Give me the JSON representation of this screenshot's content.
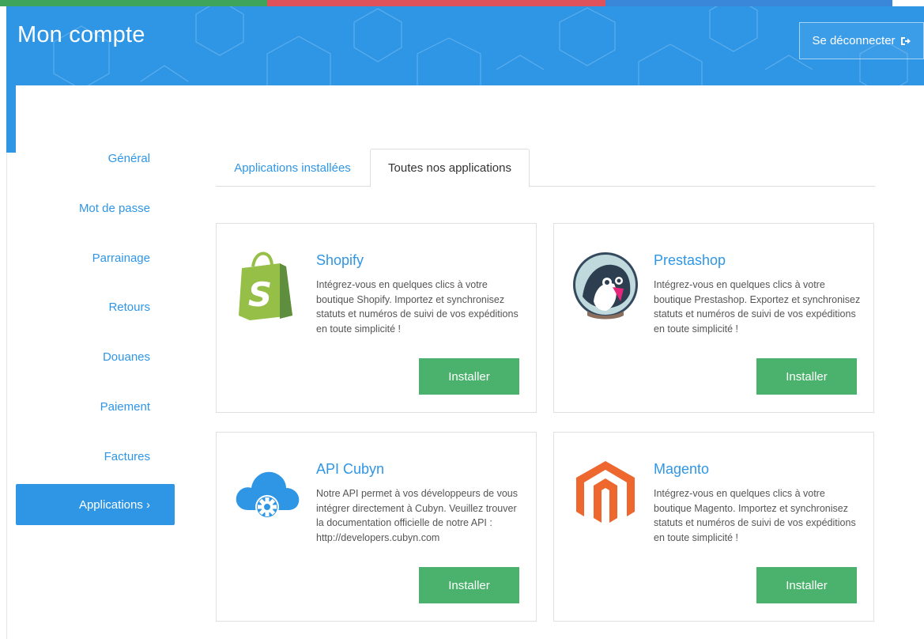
{
  "header": {
    "title": "Mon compte",
    "logout_label": "Se déconnecter",
    "logout_icon": "sign-out-icon"
  },
  "sidebar": {
    "items": [
      {
        "label": "Général"
      },
      {
        "label": "Mot de passe"
      },
      {
        "label": "Parrainage"
      },
      {
        "label": "Retours"
      },
      {
        "label": "Douanes"
      },
      {
        "label": "Paiement"
      },
      {
        "label": "Factures"
      },
      {
        "label": "Applications ›",
        "active": true
      }
    ]
  },
  "tabs": [
    {
      "label": "Applications installées",
      "active": false
    },
    {
      "label": "Toutes nos applications",
      "active": true
    }
  ],
  "apps": [
    {
      "name": "Shopify",
      "icon": "shopify-logo",
      "description": "Intégrez-vous en quelques clics à votre boutique Shopify. Importez et synchronisez statuts et numéros de suivi de vos expéditions en toute simplicité !",
      "button_label": "Installer"
    },
    {
      "name": "Prestashop",
      "icon": "prestashop-logo",
      "description": "Intégrez-vous en quelques clics à votre boutique Prestashop. Exportez et synchronisez statuts et numéros de suivi de vos expéditions en toute simplicité !",
      "button_label": "Installer"
    },
    {
      "name": "API Cubyn",
      "icon": "cloud-gear-logo",
      "description": "Notre API permet à vos développeurs de vous intégrer directement à Cubyn. Veuillez trouver la documentation officielle de notre API : http://developers.cubyn.com",
      "button_label": "Installer"
    },
    {
      "name": "Magento",
      "icon": "magento-logo",
      "description": "Intégrez-vous en quelques clics à votre boutique Magento. Importez et synchronisez statuts et numéros de suivi de vos expéditions en toute simplicité !",
      "button_label": "Installer"
    }
  ],
  "colors": {
    "primary_blue": "#2f96e6",
    "install_green": "#4ab26d",
    "bar_green": "#3fa45b",
    "bar_red": "#e0525b",
    "bar_blue": "#3a86d8"
  }
}
